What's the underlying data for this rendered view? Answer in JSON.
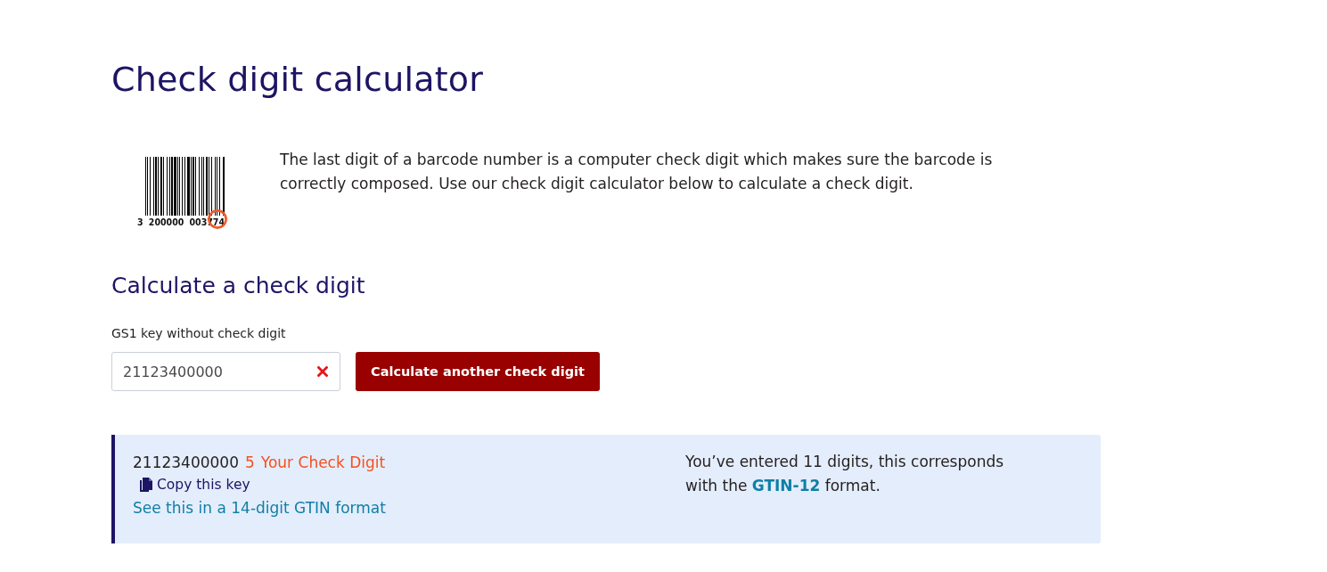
{
  "page": {
    "title": "Check digit calculator"
  },
  "intro": {
    "barcode_digits": [
      "3",
      "200000",
      "003774"
    ],
    "text": "The last digit of a barcode number is a computer check digit which makes sure the barcode is correctly composed. Use our check digit calculator below to calculate a check digit."
  },
  "calculator": {
    "heading": "Calculate a check digit",
    "field": {
      "label": "GS1 key without check digit",
      "value": "21123400000"
    },
    "button": "Calculate another check digit"
  },
  "result": {
    "key": "21123400000",
    "check_digit": "5",
    "check_digit_label": "Your Check Digit",
    "copy_link": "Copy this key",
    "gtin14_link": "See this in a 14-digit GTIN format",
    "info_before": "You’ve entered 11 digits, this corresponds with the ",
    "info_link": "GTIN-12",
    "info_after": " format."
  }
}
